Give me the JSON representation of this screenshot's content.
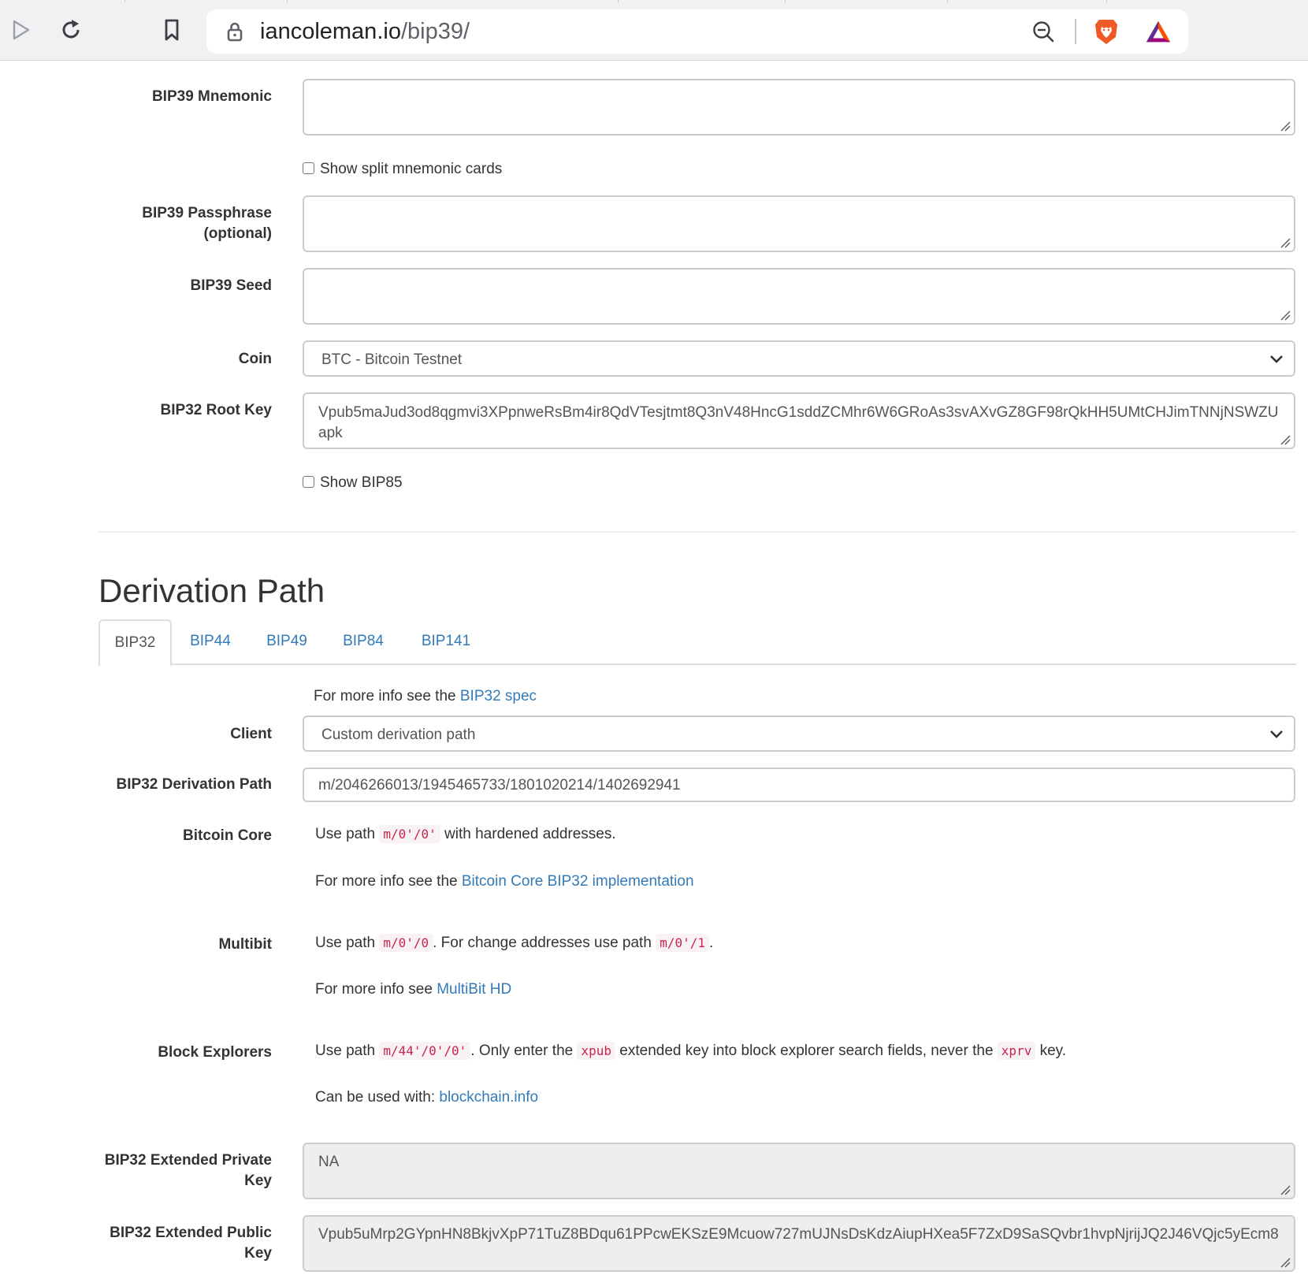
{
  "browser": {
    "url_domain": "iancoleman.io",
    "url_path": "/bip39/"
  },
  "form": {
    "mnemonic_label": "BIP39 Mnemonic",
    "mnemonic_value": "",
    "split_cards_label": "Show split mnemonic cards",
    "passphrase_label_line1": "BIP39 Passphrase",
    "passphrase_label_line2": "(optional)",
    "passphrase_value": "",
    "seed_label": "BIP39 Seed",
    "seed_value": "",
    "coin_label": "Coin",
    "coin_value": "BTC - Bitcoin Testnet",
    "root_key_label": "BIP32 Root Key",
    "root_key_value": "Vpub5maJud3od8qgmvi3XPpnweRsBm4ir8QdVTesjtmt8Q3nV48HncG1sddZCMhr6W6GRoAs3svAXvGZ8GF98rQkHH5UMtCHJimTNNjNSWZUapk",
    "show_bip85_label": "Show BIP85"
  },
  "derivation": {
    "heading": "Derivation Path",
    "tabs": [
      "BIP32",
      "BIP44",
      "BIP49",
      "BIP84",
      "BIP141"
    ],
    "active_tab": "BIP32",
    "spec_prefix": "For more info see the",
    "spec_link": "BIP32 spec",
    "client_label": "Client",
    "client_value": "Custom derivation path",
    "path_label": "BIP32 Derivation Path",
    "path_value": "m/2046266013/1945465733/1801020214/1402692941",
    "bitcoin_core": {
      "label": "Bitcoin Core",
      "use_path": "Use path",
      "path_code": "m/0'/0'",
      "suffix": "with hardened addresses.",
      "info_prefix": "For more info see the",
      "info_link": "Bitcoin Core BIP32 implementation"
    },
    "multibit": {
      "label": "Multibit",
      "use_path": "Use path",
      "path_code": "m/0'/0",
      "middle": ". For change addresses use path",
      "change_code": "m/0'/1",
      "end": ".",
      "info_prefix": "For more info see",
      "info_link": "MultiBit HD"
    },
    "block_explorers": {
      "label": "Block Explorers",
      "use_path": "Use path",
      "path_code": "m/44'/0'/0'",
      "text1": ". Only enter the",
      "xpub_code": "xpub",
      "text2": "extended key into block explorer search fields, never the",
      "xprv_code": "xprv",
      "text3": "key.",
      "used_with_prefix": "Can be used with:",
      "used_with_link": "blockchain.info"
    },
    "ext_private_label_line1": "BIP32 Extended Private",
    "ext_private_label_line2": "Key",
    "ext_private_value": "NA",
    "ext_public_label_line1": "BIP32 Extended Public",
    "ext_public_label_line2": "Key",
    "ext_public_value": "Vpub5uMrp2GYpnHN8BkjvXpP71TuZ8BDqu61PPcwEKSzE9Mcuow727mUJNsDsKdzAiupHXea5F7ZxD9SaSQvbr1hvpNjrijJQ2J46VQjc5yEcm8"
  }
}
